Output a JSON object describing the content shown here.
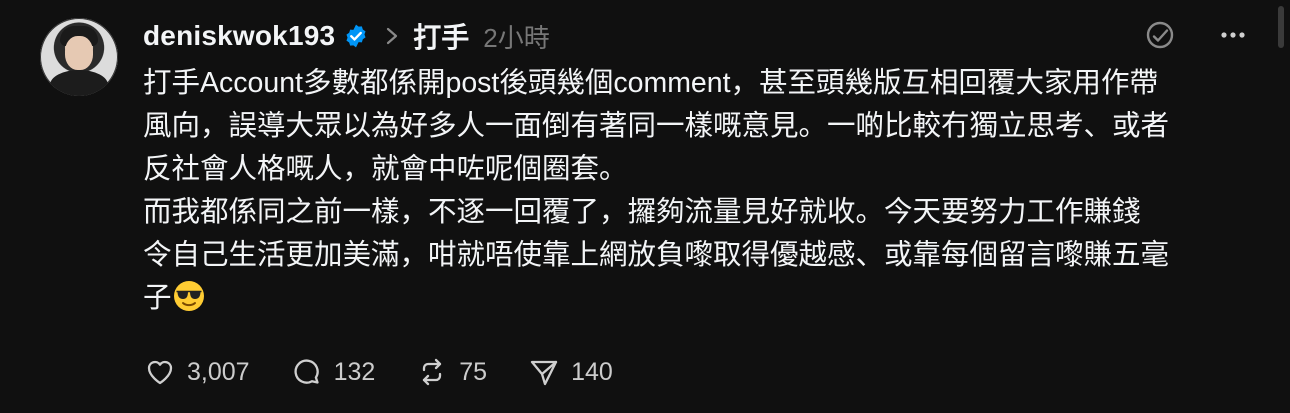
{
  "post": {
    "username": "deniskwok193",
    "topic": "打手",
    "time": "2小時",
    "text_lines": [
      "打手Account多數都係開post後頭幾個comment，甚至頭幾版互相回覆大家用作帶",
      "風向，誤導大眾以為好多人一面倒有著同一樣嘅意見。一啲比較冇獨立思考、或者",
      "反社會人格嘅人，就會中咗呢個圈套。",
      "而我都係同之前一樣，不逐一回覆了，攞夠流量見好就收。今天要努力工作賺錢",
      "令自己生活更加美滿，咁就唔使靠上網放負嚟取得優越感、或靠每個留言嚟賺五毫",
      "子"
    ],
    "emoji": "smiling-face-with-sunglasses",
    "stats": {
      "likes": "3,007",
      "replies": "132",
      "reposts": "75",
      "shares": "140"
    }
  },
  "colors": {
    "background": "#101010",
    "text": "#f3f5f7",
    "muted": "#777777",
    "verified": "#0095f6"
  }
}
